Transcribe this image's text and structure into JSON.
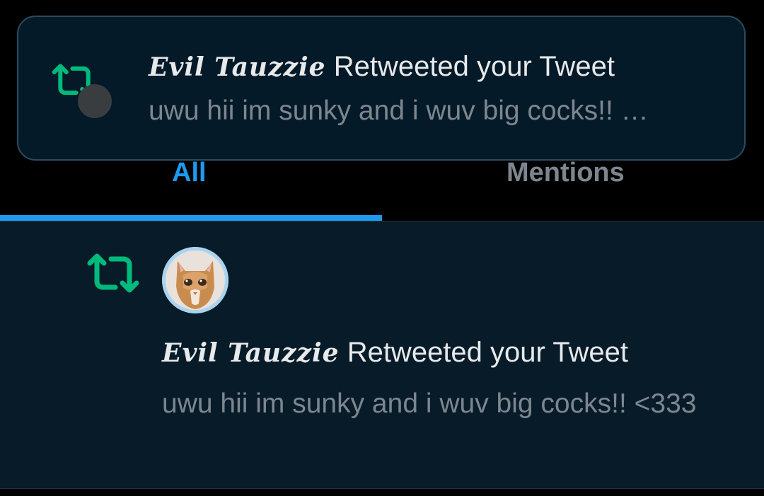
{
  "toast": {
    "username": "Evil Tauzzie",
    "action": "Retweeted your Tweet",
    "preview": "uwu hii im sunky and i wuv big cocks!! …"
  },
  "tabs": {
    "all_label": "All",
    "mentions_label": "Mentions",
    "active": "All"
  },
  "notification": {
    "username": "Evil Tauzzie",
    "action": "Retweeted your Tweet",
    "tweet_text": "uwu hii im sunky and i wuv big cocks!! <333"
  },
  "colors": {
    "background": "#000000",
    "notification_bg": "#071b29",
    "accent": "#1d9bf0",
    "retweet_green": "#00ba7c",
    "secondary_text": "#7d868f",
    "primary_text": "#e7e9ea"
  },
  "icons": {
    "toast_icon": "retweet-icon",
    "notification_icon": "retweet-icon",
    "avatar": "cat-avatar"
  }
}
